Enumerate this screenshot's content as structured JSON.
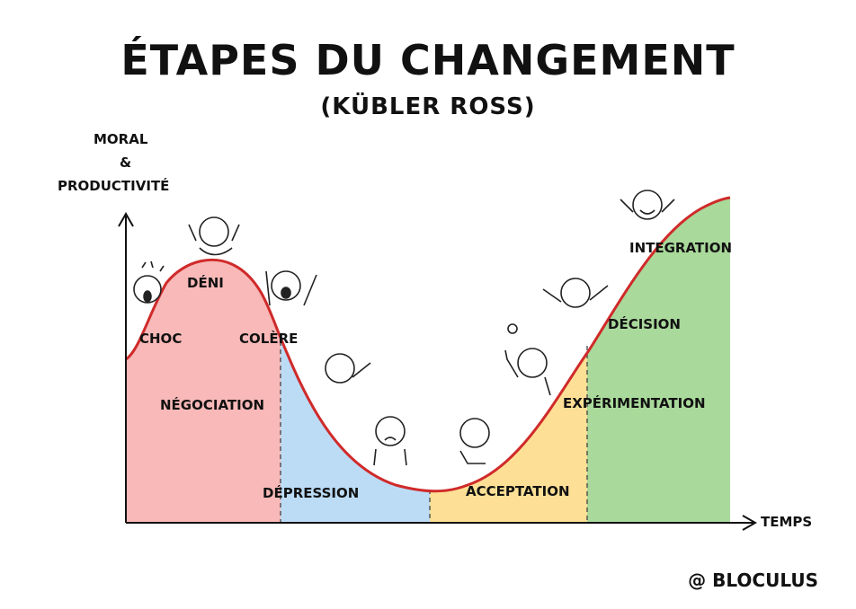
{
  "title": "ÉTAPES DU CHANGEMENT",
  "subtitle": "(KÜBLER ROSS)",
  "y_axis": {
    "line1": "MORAL",
    "line2": "&",
    "line3": "PRODUCTIVITÉ"
  },
  "x_axis": "TEMPS",
  "stages": {
    "choc": "CHOC",
    "deni": "DÉNI",
    "colere": "COLÈRE",
    "negociation": "NÉGOCIATION",
    "depression": "DÉPRESSION",
    "acceptation": "ACCEPTATION",
    "experimentation": "EXPÉRIMENTATION",
    "decision": "DÉCISION",
    "integration": "INTEGRATION"
  },
  "zones": [
    {
      "name": "zone-1",
      "color": "#f8b9b8"
    },
    {
      "name": "zone-2",
      "color": "#bcdcf6"
    },
    {
      "name": "zone-3",
      "color": "#fde095"
    },
    {
      "name": "zone-4",
      "color": "#a9d99b"
    }
  ],
  "curve_color": "#d02a2a",
  "credit": "@ BLOCULUS"
}
